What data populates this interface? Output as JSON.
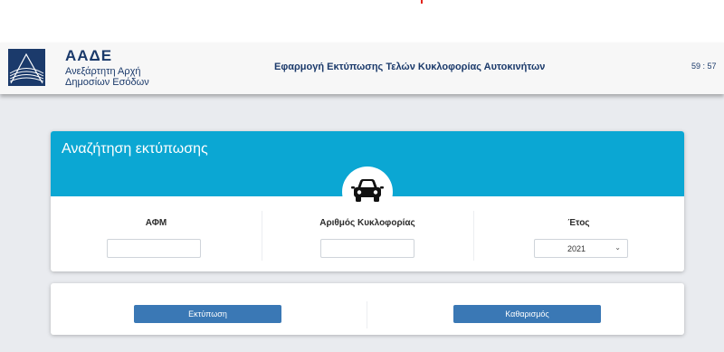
{
  "header": {
    "logo_title": "ΑΑΔΕ",
    "logo_sub1": "Ανεξάρτητη Αρχή",
    "logo_sub2": "Δημοσίων Εσόδων",
    "app_title": "Εφαρμογή Εκτύπωσης Τελών Κυκλοφορίας Αυτοκινήτων",
    "timer": "59 : 57"
  },
  "search": {
    "title": "Αναζήτηση εκτύπωσης",
    "fields": {
      "afm": {
        "label": "ΑΦΜ",
        "value": "",
        "placeholder": ""
      },
      "plate": {
        "label": "Αριθμός Κυκλοφορίας",
        "value": "",
        "placeholder": ""
      },
      "year": {
        "label": "Έτος",
        "value": "2021"
      }
    }
  },
  "actions": {
    "print_label": "Εκτύπωση",
    "clear_label": "Καθαρισμός"
  },
  "colors": {
    "brand": "#1b3a6b",
    "card_header": "#0ba7d3",
    "button": "#3a78b5",
    "background": "#e9ebef"
  },
  "icons": {
    "logo": "aade-logo-icon",
    "car": "car-icon",
    "select_chevron": "chevron-down-icon"
  }
}
